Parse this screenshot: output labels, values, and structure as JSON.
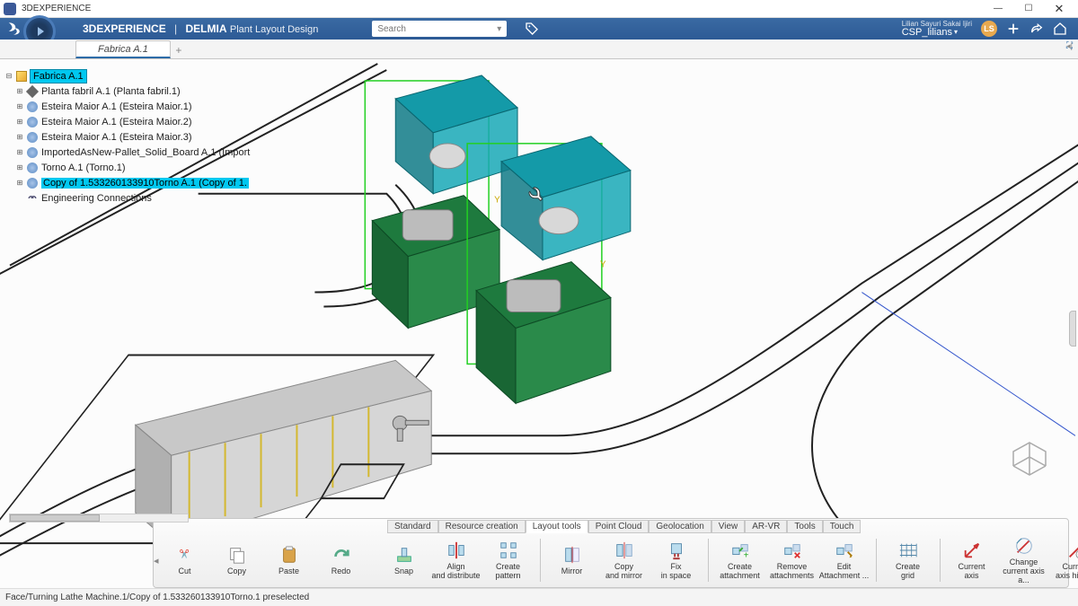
{
  "os": {
    "title": "3DEXPERIENCE"
  },
  "header": {
    "brand_prefix": "3D",
    "brand_main": "EXPERIENCE",
    "brand_suite": "DELMIA",
    "module": "Plant Layout Design",
    "search_placeholder": "Search",
    "user_full": "Lilian Sayuri Sakai Ijiri",
    "user_role": "CSP_lilians",
    "avatar_initials": "LS"
  },
  "tabs": {
    "active": "Fabrica A.1"
  },
  "tree": {
    "root": "Fabrica A.1",
    "items": [
      {
        "label": "Planta fabril A.1 (Planta fabril.1)",
        "icon": "diamond"
      },
      {
        "label": "Esteira Maior A.1 (Esteira Maior.1)",
        "icon": "gear"
      },
      {
        "label": "Esteira Maior A.1 (Esteira Maior.2)",
        "icon": "gear"
      },
      {
        "label": "Esteira Maior A.1 (Esteira Maior.3)",
        "icon": "gear"
      },
      {
        "label": "ImportedAsNew-Pallet_Solid_Board A.1 (Import",
        "icon": "gear"
      },
      {
        "label": "Torno A.1 (Torno.1)",
        "icon": "gear"
      },
      {
        "label": "Copy of 1.533260133910Torno A.1 (Copy of 1.",
        "icon": "gear",
        "selected": true
      },
      {
        "label": "Engineering Connections",
        "icon": "chain"
      }
    ]
  },
  "ribbon": {
    "tabs": [
      "Standard",
      "Resource creation",
      "Layout tools",
      "Point Cloud",
      "Geolocation",
      "View",
      "AR-VR",
      "Tools",
      "Touch"
    ],
    "active_tab": "Layout tools",
    "clipboard": [
      {
        "label": "Cut"
      },
      {
        "label": "Copy"
      },
      {
        "label": "Paste"
      },
      {
        "label": "Redo"
      }
    ],
    "tools": [
      {
        "label": "Snap"
      },
      {
        "label": "Align\nand distribute"
      },
      {
        "label": "Create\npattern"
      },
      {
        "label": "Mirror"
      },
      {
        "label": "Copy\nand mirror"
      },
      {
        "label": "Fix\nin space"
      },
      {
        "label": "Create\nattachment"
      },
      {
        "label": "Remove\nattachments"
      },
      {
        "label": "Edit\nAttachment ..."
      },
      {
        "label": "Create\ngrid"
      },
      {
        "label": "Current\naxis"
      },
      {
        "label": "Change\ncurrent axis a..."
      },
      {
        "label": "Current\naxis history"
      }
    ]
  },
  "status": {
    "text": "Face/Turning Lathe Machine.1/Copy of 1.533260133910Torno.1 preselected"
  }
}
